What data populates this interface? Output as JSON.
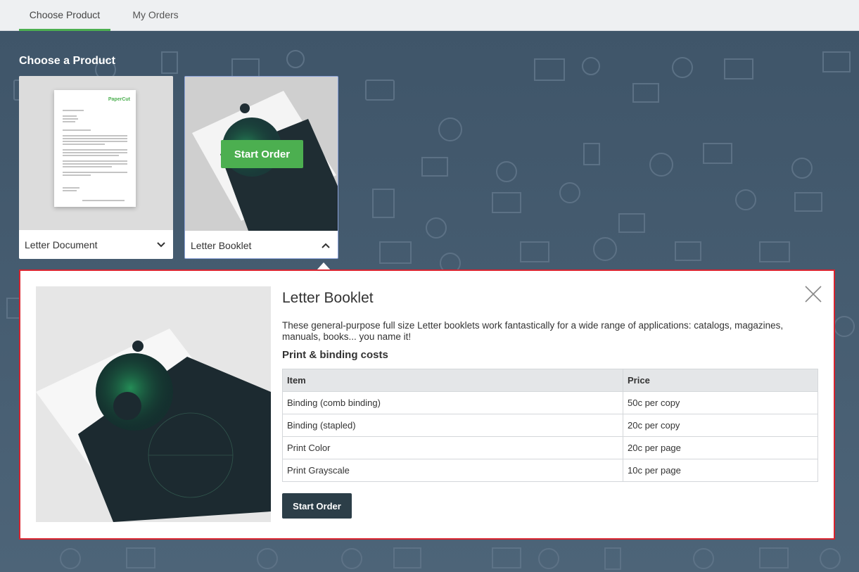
{
  "nav": {
    "tabs": [
      {
        "label": "Choose Product",
        "active": true
      },
      {
        "label": "My Orders",
        "active": false
      }
    ]
  },
  "section_title": "Choose a Product",
  "products": [
    {
      "name": "Letter Document",
      "expanded": false,
      "logo_text": "PaperCut"
    },
    {
      "name": "Letter Booklet",
      "expanded": true,
      "overlay_button": "Start Order"
    }
  ],
  "detail": {
    "title": "Letter Booklet",
    "description": "These general-purpose full size Letter booklets work fantastically for a wide range of applications: catalogs, magazines, manuals, books... you name it!",
    "costs_title": "Print & binding costs",
    "table": {
      "headers": [
        "Item",
        "Price"
      ],
      "rows": [
        [
          "Binding (comb binding)",
          "50c per copy"
        ],
        [
          "Binding (stapled)",
          "20c per copy"
        ],
        [
          "Print Color",
          "20c per page"
        ],
        [
          "Print Grayscale",
          "10c per page"
        ]
      ]
    },
    "order_button": "Start Order",
    "close_icon": "close-icon"
  },
  "colors": {
    "accent_green": "#4caf50",
    "highlight_border": "#d9232e",
    "dark_button": "#2c3e48",
    "background": "#4a6176"
  }
}
